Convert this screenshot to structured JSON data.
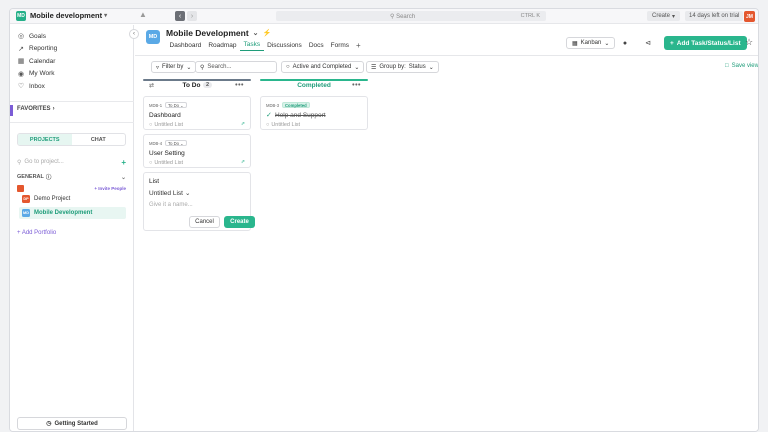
{
  "topbar": {
    "workspace_initials": "MD",
    "workspace_name": "Mobile development",
    "search_label": "Search",
    "search_shortcut": "CTRL K",
    "create_label": "Create",
    "trial_label": "14 days left on trial",
    "avatar_initials": "JM"
  },
  "sidebar": {
    "nav": [
      {
        "icon": "goals-icon",
        "label": "Goals"
      },
      {
        "icon": "reporting-icon",
        "label": "Reporting"
      },
      {
        "icon": "calendar-icon",
        "label": "Calendar"
      },
      {
        "icon": "my-work-icon",
        "label": "My Work"
      },
      {
        "icon": "inbox-icon",
        "label": "Inbox"
      }
    ],
    "favorites_label": "FAVORITES",
    "segment": {
      "projects": "PROJECTS",
      "chat": "CHAT"
    },
    "project_search_placeholder": "Go to project...",
    "general_label": "GENERAL",
    "invite_label": "+ Invite People",
    "projects": [
      {
        "initials": "DP",
        "name": "Demo Project",
        "color": "#e4572e"
      },
      {
        "initials": "MD",
        "name": "Mobile Development",
        "color": "#5aa9e6"
      }
    ],
    "add_portfolio": "+ Add Portfolio",
    "getting_started": "Getting Started"
  },
  "header": {
    "project_initials": "MD",
    "project_title": "Mobile Development",
    "tabs": [
      "Dashboard",
      "Roadmap",
      "Tasks",
      "Discussions",
      "Docs",
      "Forms"
    ],
    "active_tab": "Tasks",
    "view_label": "Kanban",
    "add_button": "Add Task/Status/List"
  },
  "toolbar": {
    "filter_by": "Filter by",
    "search_placeholder": "Search...",
    "active_completed": "Active and Completed",
    "group_by": "Group by:",
    "group_value": "Status",
    "save_view": "Save view"
  },
  "columns": [
    {
      "name": "To Do",
      "count": "2",
      "color": "#6b7a8a",
      "cards": [
        {
          "code": "MDB-1",
          "status": "To Do",
          "title": "Dashboard",
          "list": "Untitled List"
        },
        {
          "code": "MDB-4",
          "status": "To Do",
          "title": "User Setting",
          "list": "Untitled List"
        }
      ]
    },
    {
      "name": "Completed",
      "color": "#2ab68d",
      "cards": [
        {
          "code": "MDB-3",
          "status": "Completed",
          "title": "Help and Support",
          "list": "Untitled List"
        }
      ]
    }
  ],
  "new_list": {
    "label": "List",
    "select_value": "Untitled List",
    "name_placeholder": "Give it a name...",
    "cancel": "Cancel",
    "create": "Create"
  }
}
